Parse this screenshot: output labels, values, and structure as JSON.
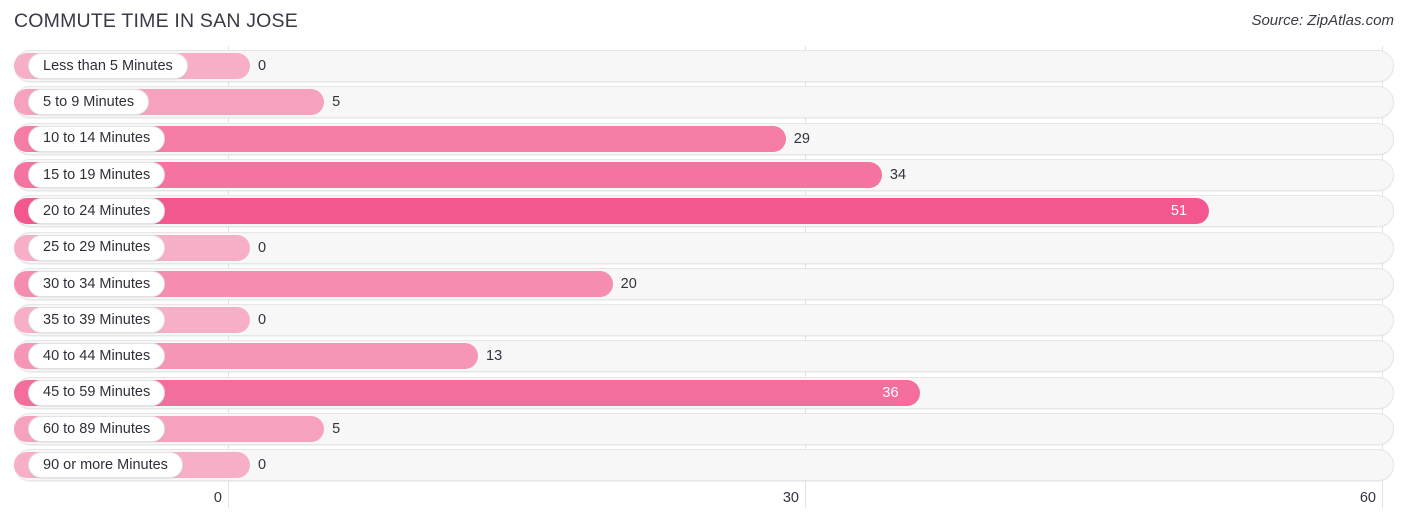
{
  "header": {
    "title": "COMMUTE TIME IN SAN JOSE",
    "source": "Source: ZipAtlas.com"
  },
  "chart_data": {
    "type": "bar",
    "orientation": "horizontal",
    "title": "COMMUTE TIME IN SAN JOSE",
    "source": "Source: ZipAtlas.com",
    "xlabel": "",
    "ylabel": "",
    "xlim": [
      0,
      60
    ],
    "xticks": [
      0,
      30,
      60
    ],
    "xtick_labels": [
      "0",
      "30",
      "60"
    ],
    "grid": true,
    "legend": false,
    "categories": [
      "Less than 5 Minutes",
      "5 to 9 Minutes",
      "10 to 14 Minutes",
      "15 to 19 Minutes",
      "20 to 24 Minutes",
      "25 to 29 Minutes",
      "30 to 34 Minutes",
      "35 to 39 Minutes",
      "40 to 44 Minutes",
      "45 to 59 Minutes",
      "60 to 89 Minutes",
      "90 or more Minutes"
    ],
    "values": [
      0,
      5,
      29,
      34,
      51,
      0,
      20,
      0,
      13,
      36,
      5,
      0
    ],
    "value_labels": [
      "0",
      "5",
      "29",
      "34",
      "51",
      "0",
      "20",
      "0",
      "13",
      "36",
      "5",
      "0"
    ],
    "bar_colors": [
      "#F7AFC8",
      "#F6A2BE",
      "#F47CA5",
      "#F473A0",
      "#F2588F",
      "#F7AFC8",
      "#F58DB0",
      "#F7AFC8",
      "#F596B6",
      "#F36E9C",
      "#F6A2BE",
      "#F7AFC8"
    ],
    "label_inside": [
      false,
      false,
      false,
      false,
      true,
      false,
      false,
      false,
      false,
      true,
      false,
      false
    ]
  },
  "colors": {
    "track_fill": "#F7F7F8",
    "track_border": "#E6E6E8",
    "gridline": "#E3E3E6",
    "text": "#33333F",
    "accent": "#F2588F"
  }
}
